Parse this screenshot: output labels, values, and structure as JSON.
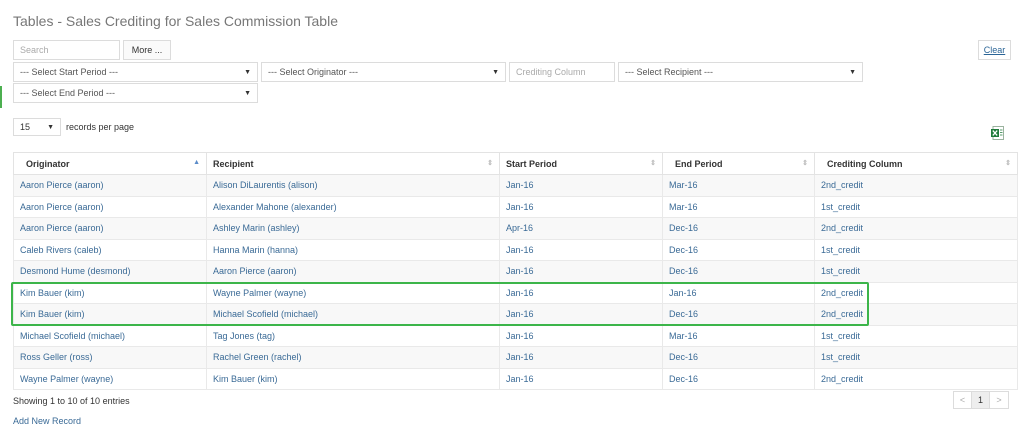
{
  "page": {
    "title": "Tables - Sales Crediting for Sales Commission Table"
  },
  "filters": {
    "search_placeholder": "Search",
    "more_label": "More ...",
    "start_period": "--- Select Start Period ---",
    "originator": "--- Select Originator ---",
    "crediting_column_placeholder": "Crediting Column",
    "recipient": "--- Select Recipient ---",
    "end_period": "--- Select End Period ---",
    "clear_label": "Clear"
  },
  "records_per_page": {
    "value": "15",
    "label": "records per page"
  },
  "table": {
    "columns": [
      "Originator",
      "Recipient",
      "Start Period",
      "End Period",
      "Crediting Column"
    ],
    "rows": [
      [
        "Aaron Pierce (aaron)",
        "Alison DiLaurentis (alison)",
        "Jan-16",
        "Mar-16",
        "2nd_credit"
      ],
      [
        "Aaron Pierce (aaron)",
        "Alexander Mahone (alexander)",
        "Jan-16",
        "Mar-16",
        "1st_credit"
      ],
      [
        "Aaron Pierce (aaron)",
        "Ashley Marin (ashley)",
        "Apr-16",
        "Dec-16",
        "2nd_credit"
      ],
      [
        "Caleb Rivers (caleb)",
        "Hanna Marin (hanna)",
        "Jan-16",
        "Dec-16",
        "1st_credit"
      ],
      [
        "Desmond Hume (desmond)",
        "Aaron Pierce (aaron)",
        "Jan-16",
        "Dec-16",
        "1st_credit"
      ],
      [
        "Kim Bauer (kim)",
        "Wayne Palmer (wayne)",
        "Jan-16",
        "Jan-16",
        "2nd_credit"
      ],
      [
        "Kim Bauer (kim)",
        "Michael Scofield (michael)",
        "Jan-16",
        "Dec-16",
        "2nd_credit"
      ],
      [
        "Michael Scofield (michael)",
        "Tag Jones (tag)",
        "Jan-16",
        "Mar-16",
        "1st_credit"
      ],
      [
        "Ross Geller (ross)",
        "Rachel Green (rachel)",
        "Jan-16",
        "Dec-16",
        "1st_credit"
      ],
      [
        "Wayne Palmer (wayne)",
        "Kim Bauer (kim)",
        "Jan-16",
        "Dec-16",
        "2nd_credit"
      ]
    ]
  },
  "footer": {
    "showing": "Showing 1 to 10 of 10 entries",
    "pager": {
      "prev": "<",
      "current": "1",
      "next": ">"
    },
    "add_new": "Add New Record"
  },
  "icons": {
    "excel": "excel-export-icon",
    "sort_asc": "▲",
    "sort_both": "⇕",
    "caret": "▼"
  },
  "colors": {
    "highlight": "#3cb54a",
    "link": "#3a6a96",
    "excel": "#1f7a3a"
  }
}
